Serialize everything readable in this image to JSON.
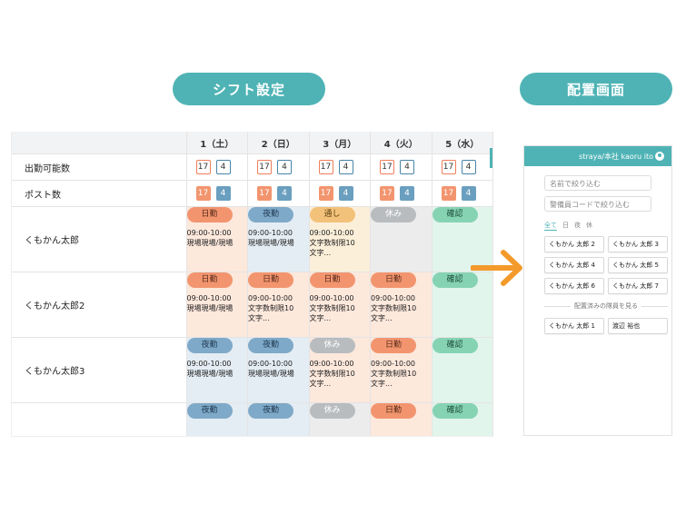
{
  "titles": {
    "shift": "シフト設定",
    "layout": "配置画面"
  },
  "table": {
    "days": [
      "1（土）",
      "2（日）",
      "3（月）",
      "4（火）",
      "5（水）"
    ],
    "available_label": "出勤可能数",
    "post_label": "ポスト数",
    "available_counts": [
      [
        "17",
        "4"
      ],
      [
        "17",
        "4"
      ],
      [
        "17",
        "4"
      ],
      [
        "17",
        "4"
      ],
      [
        "17",
        "4"
      ]
    ],
    "post_counts": [
      [
        "17",
        "4"
      ],
      [
        "17",
        "4"
      ],
      [
        "17",
        "4"
      ],
      [
        "17",
        "4"
      ],
      [
        "17",
        "4"
      ]
    ],
    "staff": [
      {
        "name": "くもかん太郎",
        "shifts": [
          {
            "tag": "日勤",
            "kind": "day",
            "time": "09:00-10:00",
            "note": "現場現場/現場"
          },
          {
            "tag": "夜勤",
            "kind": "night",
            "time": "09:00-10:00",
            "note": "現場現場/現場"
          },
          {
            "tag": "通し",
            "kind": "through",
            "time": "09:00-10:00",
            "note": "文字数制限10",
            "note2": "文字..."
          },
          {
            "tag": "休み",
            "kind": "off"
          },
          {
            "tag": "確認",
            "kind": "confirm"
          }
        ]
      },
      {
        "name": "くもかん太郎2",
        "shifts": [
          {
            "tag": "日勤",
            "kind": "day",
            "time": "09:00-10:00",
            "note": "現場現場/現場"
          },
          {
            "tag": "日勤",
            "kind": "day",
            "time": "09:00-10:00",
            "note": "文字数制限10",
            "note2": "文字..."
          },
          {
            "tag": "日勤",
            "kind": "day",
            "time": "09:00-10:00",
            "note": "文字数制限10",
            "note2": "文字..."
          },
          {
            "tag": "日勤",
            "kind": "day",
            "time": "09:00-10:00",
            "note": "文字数制限10",
            "note2": "文字..."
          },
          {
            "tag": "確認",
            "kind": "confirm"
          }
        ]
      },
      {
        "name": "くもかん太郎3",
        "shifts": [
          {
            "tag": "夜勤",
            "kind": "night",
            "time": "09:00-10:00",
            "note": "現場現場/現場"
          },
          {
            "tag": "夜勤",
            "kind": "night",
            "time": "09:00-10:00",
            "note": "現場現場/現場"
          },
          {
            "tag": "休み",
            "kind": "off",
            "time": "09:00-10:00",
            "note": "文字数制限10",
            "note2": "文字..."
          },
          {
            "tag": "日勤",
            "kind": "day",
            "time": "09:00-10:00",
            "note": "文字数制限10",
            "note2": "文字..."
          },
          {
            "tag": "確認",
            "kind": "confirm"
          }
        ]
      },
      {
        "name": "",
        "shifts": [
          {
            "tag": "夜勤",
            "kind": "night"
          },
          {
            "tag": "夜勤",
            "kind": "night"
          },
          {
            "tag": "休み",
            "kind": "off"
          },
          {
            "tag": "日勤",
            "kind": "day"
          },
          {
            "tag": "確認",
            "kind": "confirm"
          }
        ]
      }
    ]
  },
  "phone": {
    "header_text": "straya/本社  kaoru ito",
    "search_name_placeholder": "名前で絞り込む",
    "search_code_placeholder": "警備員コードで絞り込む",
    "tabs": [
      "全て",
      "日",
      "夜",
      "休"
    ],
    "staff_cards": [
      "くもかん 太郎 2",
      "くもかん 太郎 3",
      "くもかん 太郎 4",
      "くもかん 太郎 5",
      "くもかん 太郎 6",
      "くもかん 太郎 7"
    ],
    "divider_label": "配置済みの隊員を見る",
    "assigned_cards": [
      "くもかん 太郎 1",
      "渡辺 裕也"
    ]
  },
  "colors": {
    "accent": "#4fb3b5",
    "arrow": "#f39a2b",
    "day": "#f2956f",
    "night": "#7fa9c8",
    "through": "#f3c27a",
    "off": "#b9bcbf",
    "confirm": "#86d3b4"
  }
}
